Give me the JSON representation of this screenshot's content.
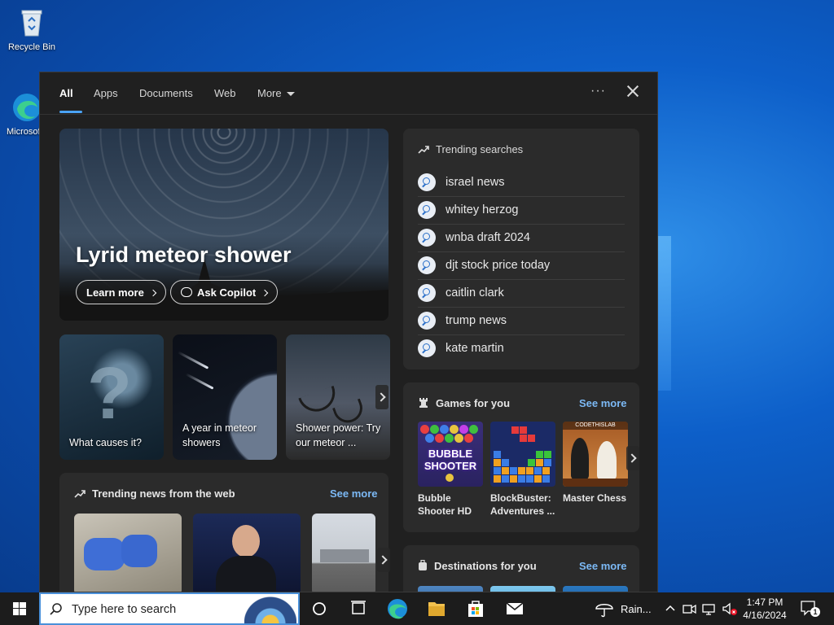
{
  "desktop": {
    "icons": [
      {
        "label": "Recycle Bin"
      },
      {
        "label": "Microsoft Edge"
      }
    ]
  },
  "panel": {
    "tabs": [
      {
        "label": "All",
        "active": true
      },
      {
        "label": "Apps"
      },
      {
        "label": "Documents"
      },
      {
        "label": "Web"
      },
      {
        "label": "More"
      }
    ],
    "more_options": "···"
  },
  "hero": {
    "title": "Lyrid meteor shower",
    "learn_more": "Learn more",
    "ask_copilot": "Ask Copilot"
  },
  "cards": [
    {
      "label": "What causes it?"
    },
    {
      "label": "A year in meteor showers"
    },
    {
      "label": "Shower power: Try our meteor ..."
    }
  ],
  "trending_searches": {
    "heading": "Trending searches",
    "items": [
      "israel news",
      "whitey herzog",
      "wnba draft 2024",
      "djt stock price today",
      "caitlin clark",
      "trump news",
      "kate martin"
    ]
  },
  "games": {
    "heading": "Games for you",
    "see_more": "See more",
    "items": [
      {
        "name": "Bubble Shooter HD",
        "thumb_text": "BUBBLE SHOOTER"
      },
      {
        "name": "BlockBuster: Adventures ..."
      },
      {
        "name": "Master Chess",
        "thumb_text": "CODETHISLAB"
      }
    ]
  },
  "news": {
    "heading": "Trending news from the web",
    "see_more": "See more"
  },
  "destinations": {
    "heading": "Destinations for you",
    "see_more": "See more"
  },
  "taskbar": {
    "search_placeholder": "Type here to search",
    "weather": "Rain...",
    "time": "1:47 PM",
    "date": "4/16/2024",
    "notification_count": "1"
  },
  "colors": {
    "accent": "#4aa3f5",
    "link": "#7cb9f5",
    "panel_bg": "#202020",
    "card_bg": "#2b2b2b"
  }
}
